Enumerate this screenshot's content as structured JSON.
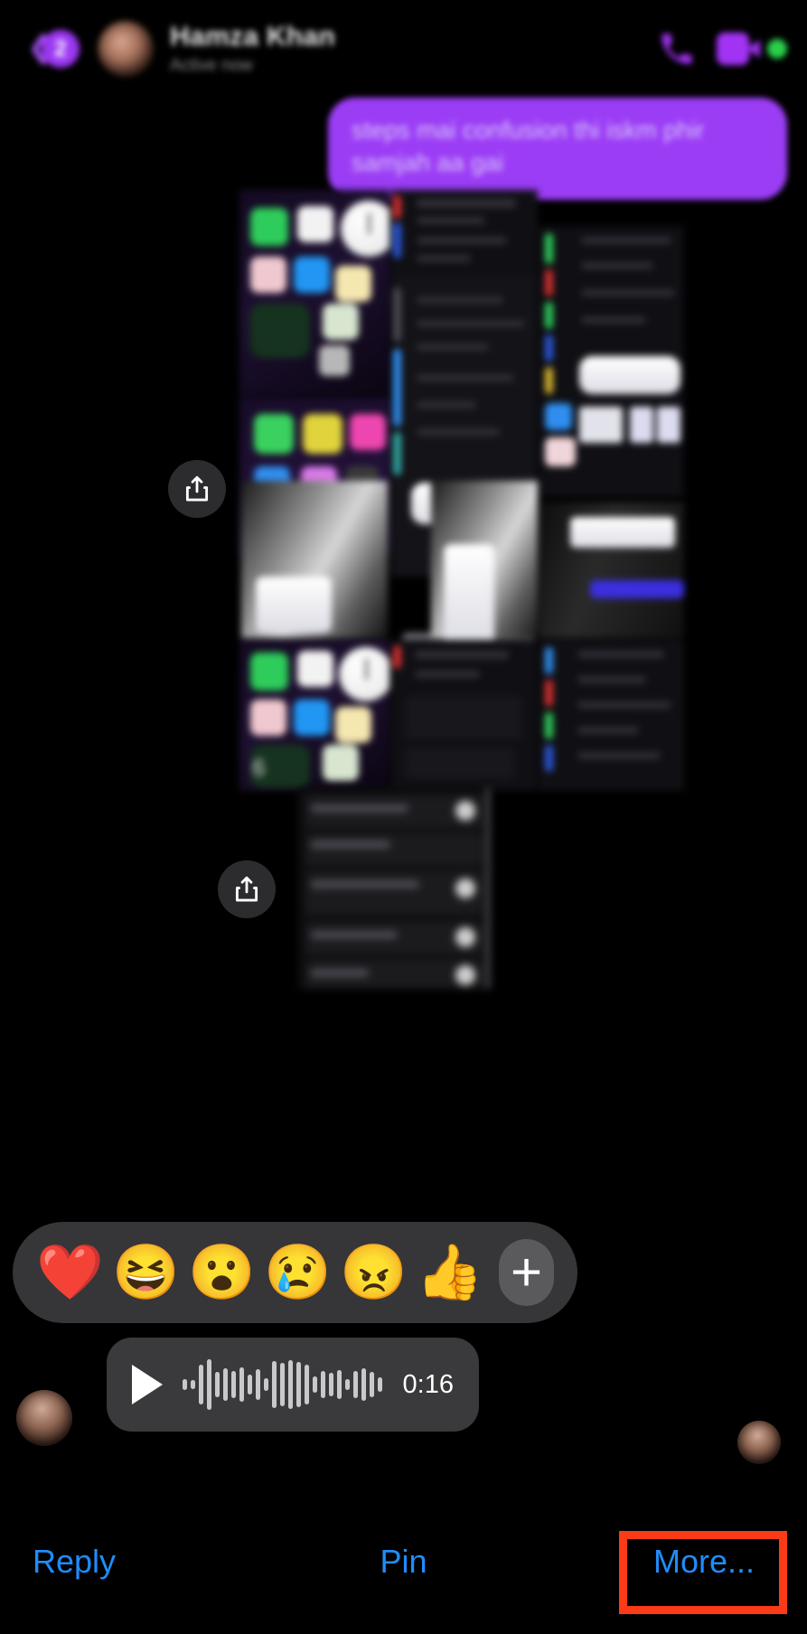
{
  "app": "messenger-conversation-message-actions",
  "header": {
    "back_badge": "2",
    "back_icon": "chevron-left-icon",
    "contact_name": "Hamza Khan",
    "contact_status": "Active now",
    "avatar": "contact-avatar",
    "audio_call_icon": "phone-icon",
    "video_call_icon": "video-camera-icon",
    "online_indicator": "online-status-dot"
  },
  "conversation": {
    "outgoing_message": {
      "text": "steps mai confusion thi iskm phir samjah aa gai",
      "bubble_color": "#9b3df5"
    },
    "attachment_1": {
      "type": "image-collage",
      "overflow_count": "6",
      "share_icon": "share-upload-icon"
    },
    "attachment_2": {
      "type": "image-screenshot",
      "share_icon": "share-upload-icon"
    },
    "voice_message": {
      "play_icon": "play-triangle-icon",
      "duration": "0:16",
      "waveform": [
        12,
        10,
        44,
        56,
        28,
        36,
        30,
        38,
        22,
        34,
        14,
        52,
        48,
        54,
        50,
        44,
        18,
        30,
        26,
        32,
        12,
        30,
        36,
        28,
        16
      ]
    },
    "sender_avatar": "sender-avatar",
    "read_receipt_avatar": "read-receipt-avatar"
  },
  "reaction_bar": {
    "background": "#363638",
    "reactions": [
      {
        "name": "heart-reaction",
        "glyph": "❤️"
      },
      {
        "name": "laugh-reaction",
        "glyph": "😆"
      },
      {
        "name": "wow-reaction",
        "glyph": "😮"
      },
      {
        "name": "sad-reaction",
        "glyph": "😢"
      },
      {
        "name": "angry-reaction",
        "glyph": "😠"
      },
      {
        "name": "thumbsup-reaction",
        "glyph": "👍"
      }
    ],
    "more_reactions_label": "+"
  },
  "bottom_actions": {
    "reply_label": "Reply",
    "pin_label": "Pin",
    "more_label": "More...",
    "link_color": "#1f8dfb",
    "highlight_color": "#fb3b18",
    "highlighted_action": "More..."
  }
}
